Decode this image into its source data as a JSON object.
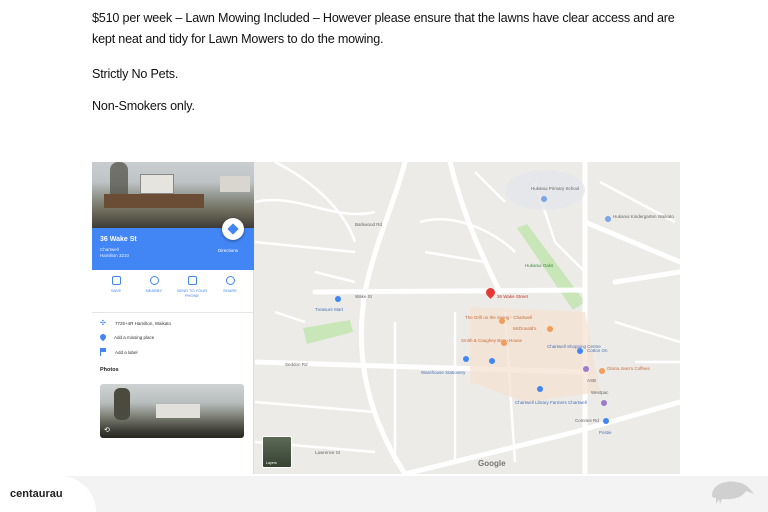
{
  "description": {
    "line1": "$510  per week – Lawn Mowing Included – However please ensure that the lawns have clear access and are kept neat and tidy for Lawn Mowers to do the mowing.",
    "line2": "Strictly No Pets.",
    "line3": "Non-Smokers only."
  },
  "place_panel": {
    "address_title": "36 Wake St",
    "suburb": "Chartwell",
    "city_code": "Hamilton 3210",
    "directions_label": "Directions",
    "actions": [
      {
        "label": "SAVE",
        "icon": "bookmark-icon"
      },
      {
        "label": "NEARBY",
        "icon": "nearby-icon"
      },
      {
        "label": "SEND TO YOUR PHONE",
        "icon": "phone-icon"
      },
      {
        "label": "SHARE",
        "icon": "share-icon"
      }
    ],
    "info_rows": [
      {
        "text": "7725+4R Hamilton, Waikato",
        "icon": "plus-code-icon"
      },
      {
        "text": "Add a missing place",
        "icon": "location-icon"
      },
      {
        "text": "Add a label",
        "icon": "flag-icon"
      }
    ],
    "photos_heading": "Photos"
  },
  "map": {
    "pin_label": "36 Wake Street",
    "labels": {
      "hukanui_primary": "Hukanui Primary School",
      "hukanui_kinder": "Hukanui Kindergarten Waikato",
      "hukanui_oaks": "Hukanui Oaks",
      "treasure_mart": "Treasure Mart",
      "grill": "The Grill on the Swing - Chartwell",
      "mcdonalds": "McDonald's",
      "smith_caughey": "Smith & Caughey Bean House",
      "chartwell_centre": "Chartwell Shopping Centre",
      "cotton_on": "Cotton On",
      "gloria_jeans": "Gloria Jean's Coffees",
      "asb": "ASB",
      "warehouse_stationery": "Warehouse Stationery",
      "library": "Chartwell Library Farmers Chartwell",
      "westpac": "Westpac",
      "postie": "Postie",
      "wake_st": "Wake St",
      "barkwood_rd": "Barkwood Rd",
      "comries_rd": "Comries Rd",
      "seddon_rd": "Seddon Rd",
      "lawrence_st": "Lawrence St"
    },
    "google_logo": "Google",
    "layers_label": "Layers"
  },
  "footer": {
    "brand": "centaurau"
  },
  "colors": {
    "accent": "#4285f4",
    "pin": "#e53935",
    "road": "#ffffff",
    "park": "#c8e6b8"
  }
}
